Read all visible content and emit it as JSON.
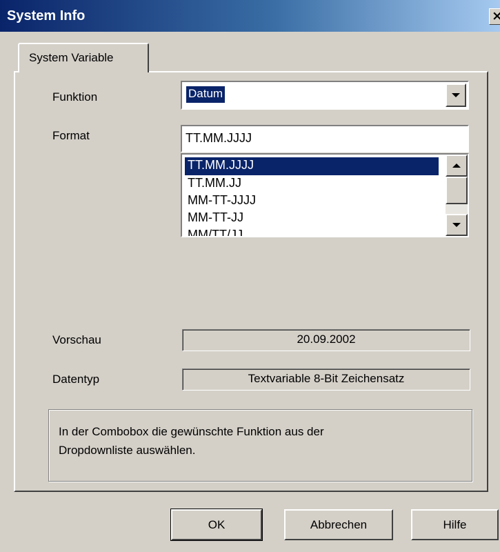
{
  "window": {
    "title": "System Info",
    "close_glyph": "×"
  },
  "tabs": [
    {
      "label": "System Variable"
    }
  ],
  "form": {
    "funktion": {
      "label": "Funktion",
      "value": "Datum"
    },
    "format": {
      "label": "Format",
      "value": "TT.MM.JJJJ",
      "options": [
        "TT.MM.JJJJ",
        "TT.MM.JJ",
        "MM-TT-JJJJ",
        "MM-TT-JJ",
        "MM/TT/JJ"
      ],
      "selected_index": 0
    },
    "vorschau": {
      "label": "Vorschau",
      "value": "20.09.2002"
    },
    "datentyp": {
      "label": "Datentyp",
      "value": "Textvariable 8-Bit Zeichensatz"
    }
  },
  "help": {
    "line1": "In der Combobox die gewünschte Funktion aus der",
    "line2": "Dropdownliste auswählen."
  },
  "buttons": {
    "ok": "OK",
    "cancel": "Abbrechen",
    "help": "Hilfe"
  },
  "colors": {
    "titlebar_start": "#0a246a",
    "titlebar_end": "#a6caf0",
    "selection": "#0a246a",
    "face": "#d4d0c8"
  }
}
